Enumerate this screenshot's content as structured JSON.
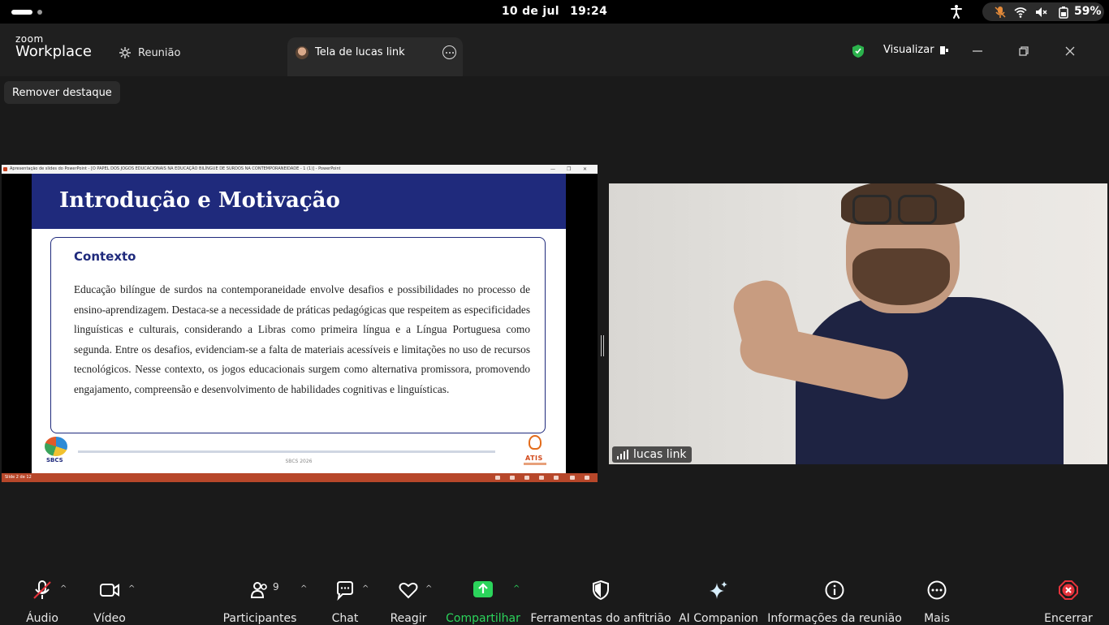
{
  "os": {
    "date": "10 de jul",
    "time": "19:24",
    "battery": "59%"
  },
  "app": {
    "logo_top": "zoom",
    "logo_bottom": "Workplace",
    "tab_meeting": "Reunião",
    "tab_screen": "Tela de lucas link",
    "view_label": "Visualizar"
  },
  "stage": {
    "remove_highlight": "Remover destaque"
  },
  "shared_screen": {
    "window_title": "Apresentação de slides do PowerPoint - [O PAPEL DOS JOGOS EDUCACIONAIS NA EDUCAÇÃO BILÍNGUE DE SURDOS NA CONTEMPORANEIDADE - 1 (1)] - PowerPoint",
    "slide_title": "Introdução e Motivação",
    "box_heading": "Contexto",
    "body": "Educação bilíngue de surdos na contemporaneidade envolve desafios e possibilidades no processo de ensino-aprendizagem. Destaca-se a necessidade de práticas pedagógicas que respeitem as especificidades linguísticas e culturais, considerando a Libras como primeira língua e a Língua Portuguesa como segunda. Entre os desafios, evidenciam-se a falta de materiais acessíveis e limitações no uso de recursos tecnológicos. Nesse contexto, os jogos educacionais surgem como alternativa promissora, promovendo engajamento, compreensão e desenvolvimento de habilidades cognitivas e linguísticas.",
    "logo_left": "SBCS",
    "footer": "SBCS 2026",
    "logo_right": "ATIS",
    "status": "Slide 2 de 12"
  },
  "video": {
    "participant_name": "lucas link"
  },
  "toolbar": {
    "audio": "Áudio",
    "video": "Vídeo",
    "participants": "Participantes",
    "participants_count": "9",
    "chat": "Chat",
    "react": "Reagir",
    "share": "Compartilhar",
    "host_tools": "Ferramentas do anfitrião",
    "ai_companion": "AI Companion",
    "meeting_info": "Informações da reunião",
    "more": "Mais",
    "end": "Encerrar"
  },
  "colors": {
    "share_green": "#2bd45b",
    "end_red": "#e5333b",
    "slide_navy": "#1f2a7c",
    "ppt_status": "#b7472a"
  }
}
